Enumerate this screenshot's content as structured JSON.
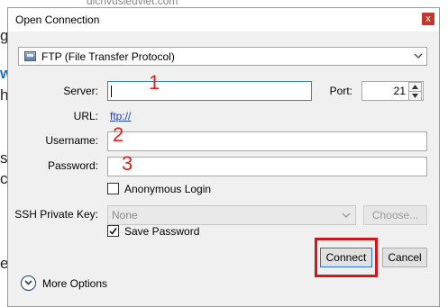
{
  "background": {
    "top_fragment": "dichvusieuviet.com",
    "left_fragments": [
      "g",
      "w",
      "h",
      "s",
      "c",
      "e"
    ]
  },
  "dialog": {
    "title": "Open Connection",
    "close_glyph": "x",
    "protocol": {
      "selected": "FTP (File Transfer Protocol)"
    },
    "server": {
      "label": "Server:",
      "value": ""
    },
    "port": {
      "label": "Port:",
      "value": "21"
    },
    "url": {
      "label": "URL:",
      "value": "ftp://"
    },
    "username": {
      "label": "Username:",
      "value": ""
    },
    "password": {
      "label": "Password:",
      "value": ""
    },
    "anonymous_login": {
      "label": "Anonymous Login",
      "checked": false
    },
    "ssh_key": {
      "label": "SSH Private Key:",
      "value": "None"
    },
    "choose_label": "Choose...",
    "save_password": {
      "label": "Save Password",
      "checked": true
    },
    "connect_label": "Connect",
    "cancel_label": "Cancel",
    "more_options_label": "More Options"
  },
  "annotations": {
    "one": "1",
    "two": "2",
    "three": "3"
  },
  "colors": {
    "accent": "#2a72d6",
    "highlight": "#d0171b",
    "annotation": "#e02020",
    "link": "#1a3fb5"
  }
}
